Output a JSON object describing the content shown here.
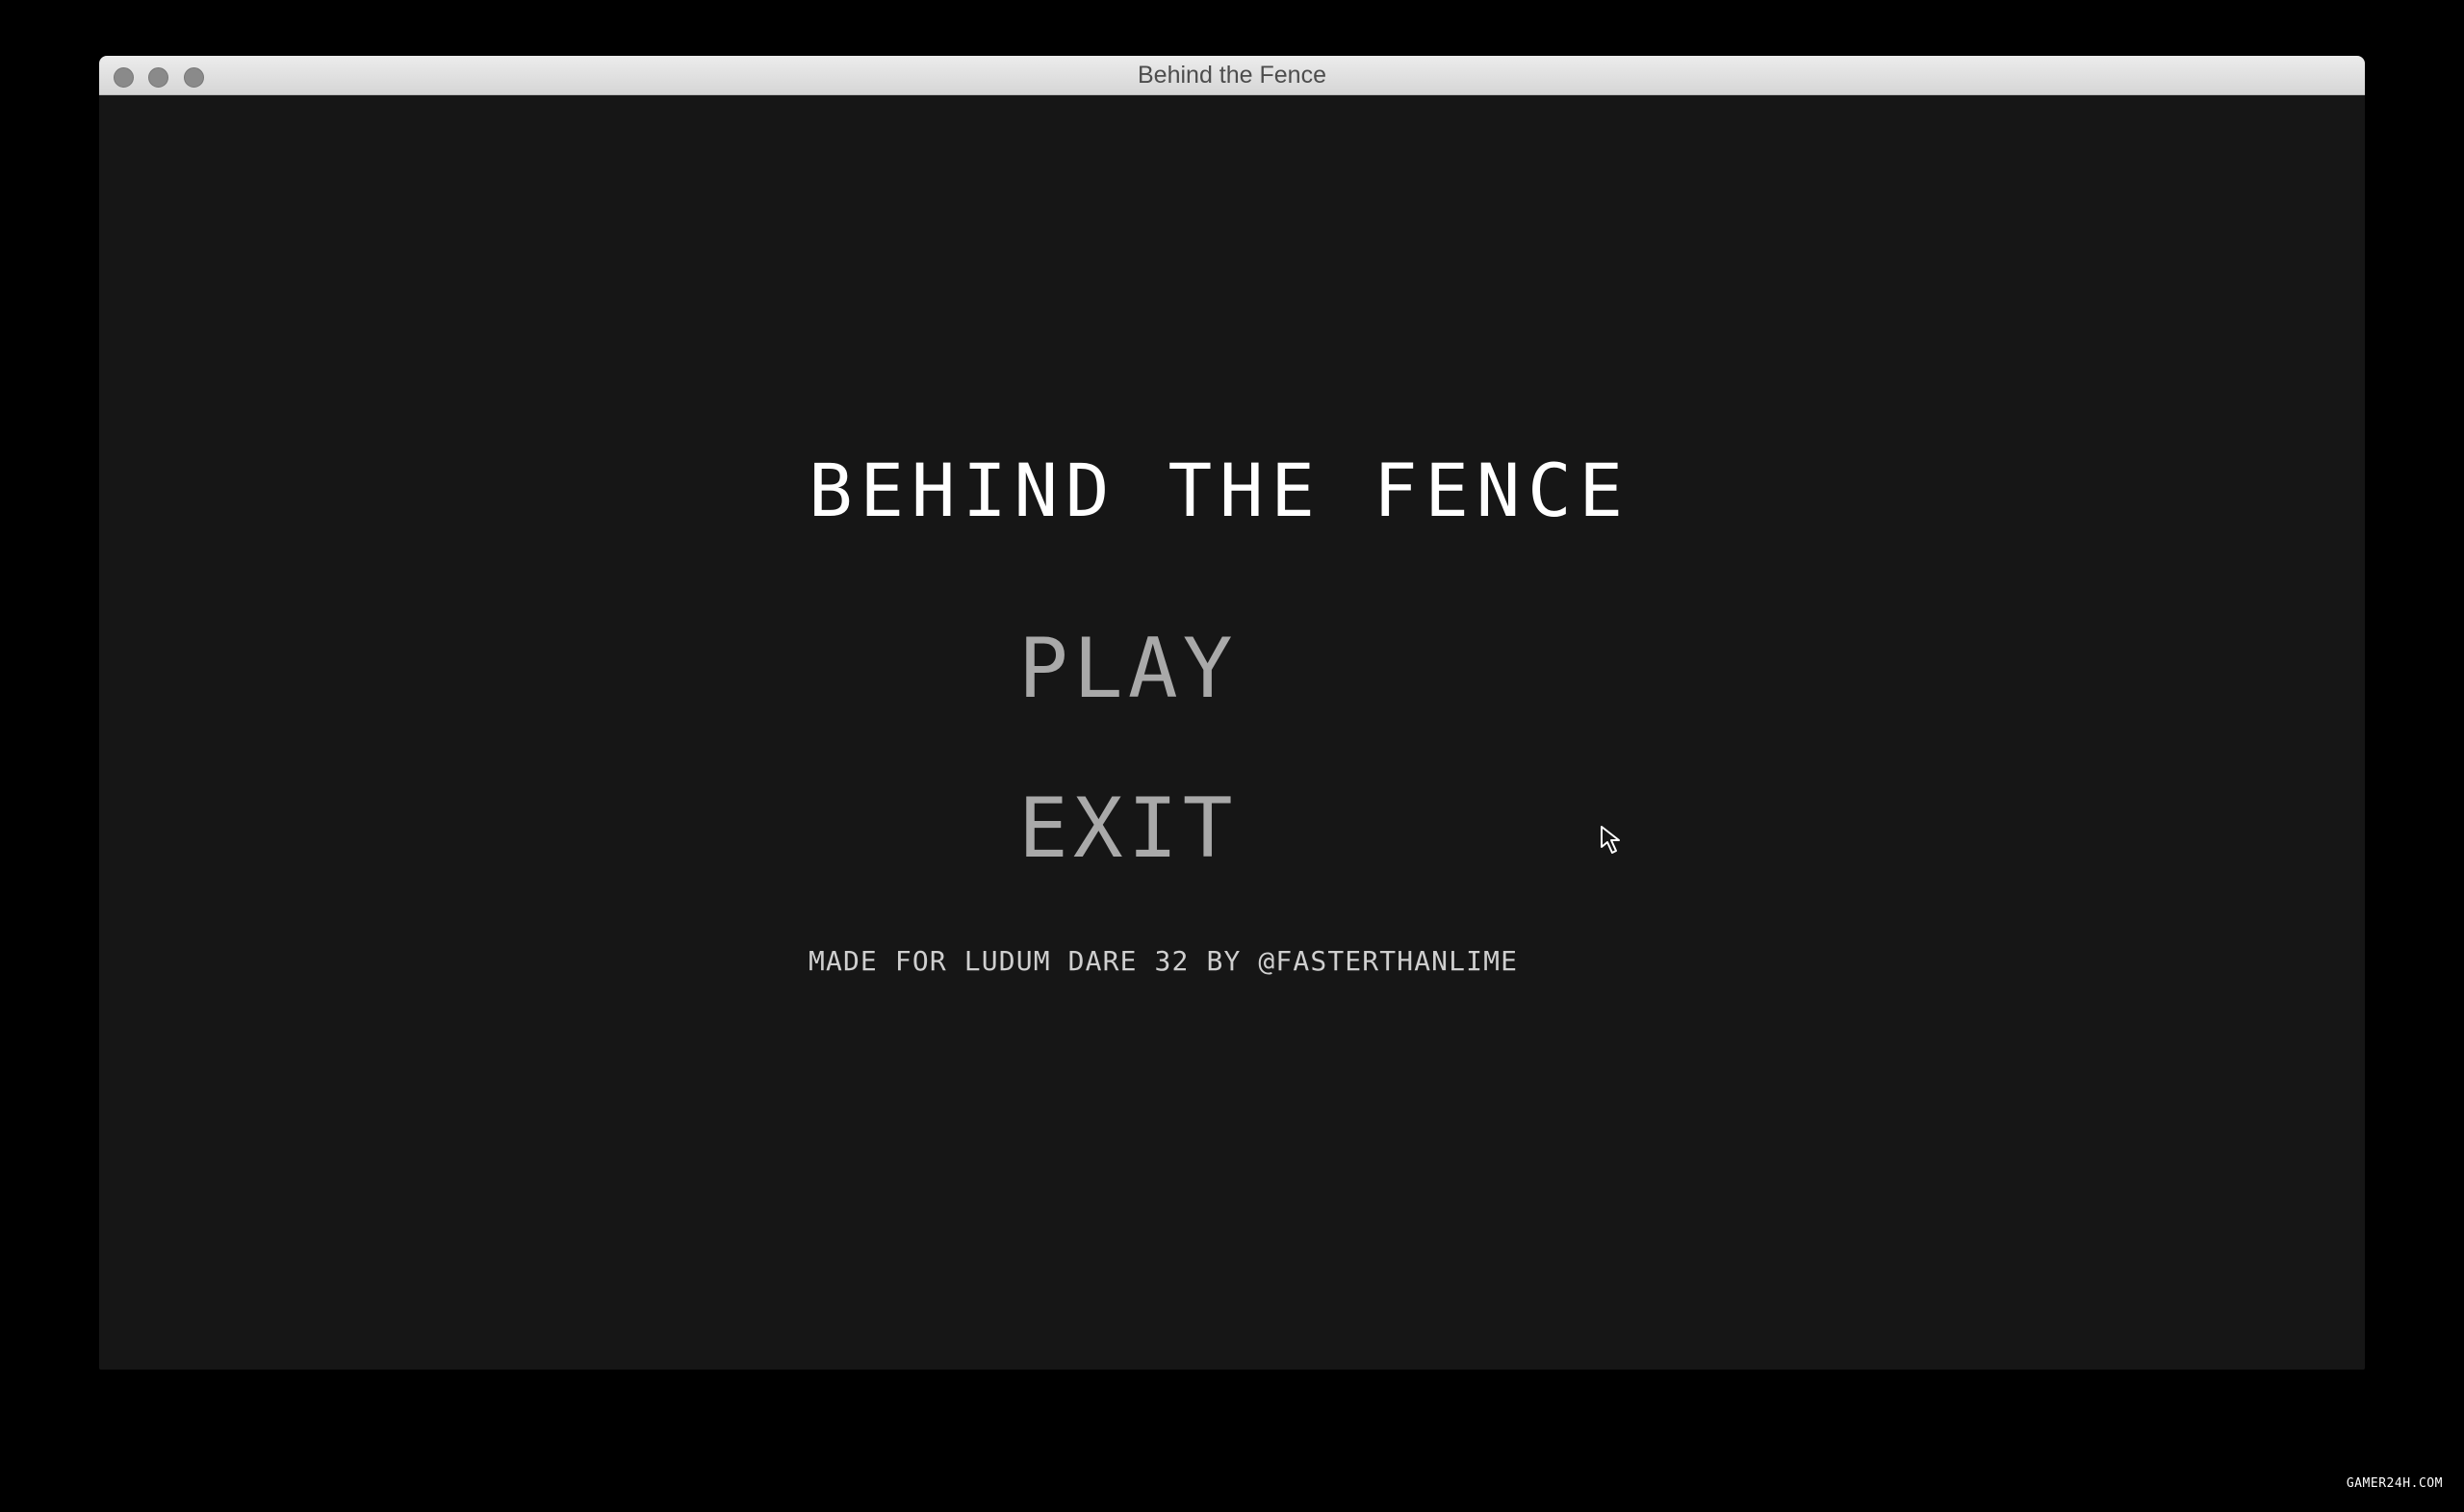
{
  "window": {
    "title": "Behind the Fence"
  },
  "menu": {
    "title": "BEHIND THE FENCE",
    "play_label": "PLAY",
    "exit_label": "EXIT",
    "credits": "MADE FOR LUDUM DARE 32 BY @FASTERTHANLIME"
  },
  "cursor": {
    "icon": "pointer-cursor-icon"
  },
  "watermark": "GAMER24H.COM",
  "colors": {
    "background": "#161616",
    "title_text": "#ffffff",
    "menu_text": "#a9a9a9"
  }
}
